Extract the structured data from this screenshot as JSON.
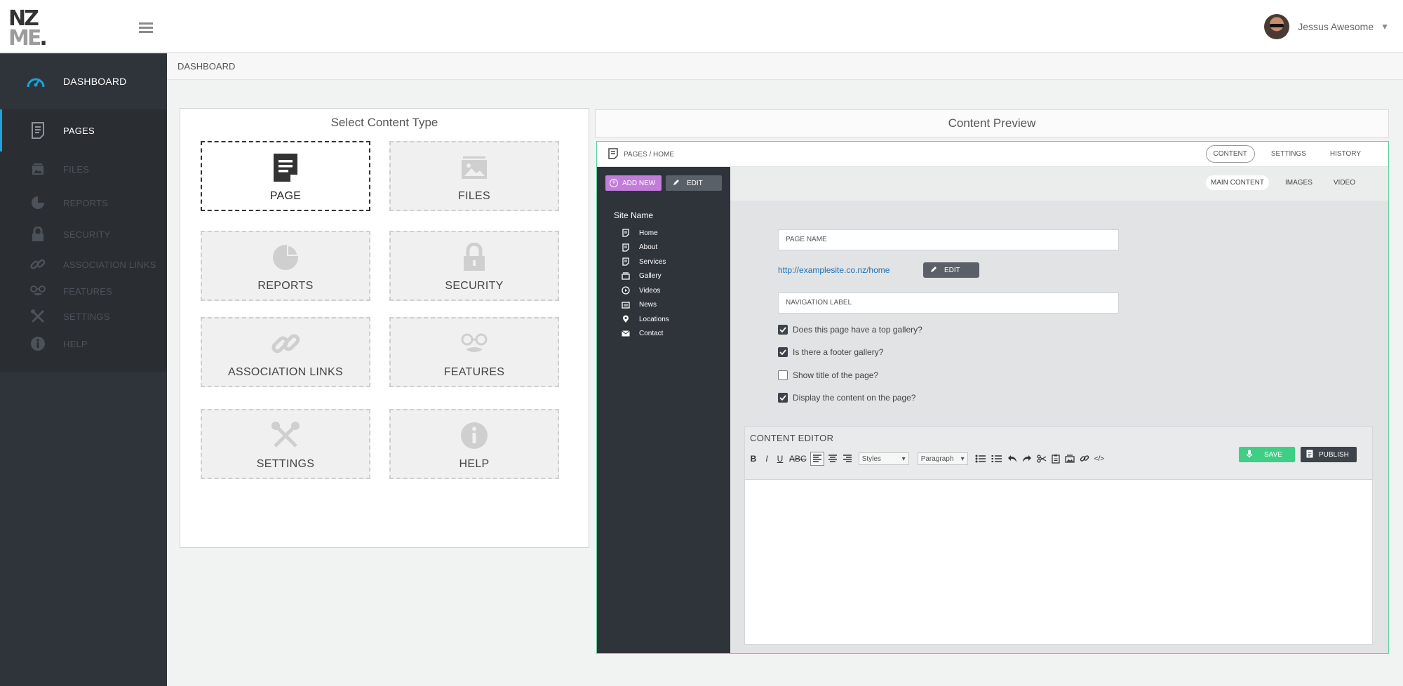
{
  "header": {
    "logo_line1": "NZ",
    "logo_line2": "ME",
    "user_name": "Jessus Awesome"
  },
  "sidebar": {
    "items": [
      {
        "label": "DASHBOARD"
      },
      {
        "label": "PAGES"
      },
      {
        "label": "FILES"
      },
      {
        "label": "REPORTS"
      },
      {
        "label": "SECURITY"
      },
      {
        "label": "ASSOCIATION LINKS"
      },
      {
        "label": "FEATURES"
      },
      {
        "label": "SETTINGS"
      },
      {
        "label": "HELP"
      }
    ]
  },
  "breadcrumb": "DASHBOARD",
  "select_panel": {
    "title": "Select Content Type",
    "tiles": [
      {
        "label": "PAGE"
      },
      {
        "label": "FILES"
      },
      {
        "label": "REPORTS"
      },
      {
        "label": "SECURITY"
      },
      {
        "label": "ASSOCIATION LINKS"
      },
      {
        "label": "FEATURES"
      },
      {
        "label": "SETTINGS"
      },
      {
        "label": "HELP"
      }
    ]
  },
  "preview": {
    "title": "Content Preview",
    "crumb": "PAGES / HOME",
    "tabs": [
      "CONTENT",
      "SETTINGS",
      "HISTORY"
    ],
    "subtabs": [
      "MAIN CONTENT",
      "IMAGES",
      "VIDEO"
    ],
    "add_new_label": "ADD NEW",
    "edit_label": "EDIT",
    "site_name": "Site Name",
    "site_items": [
      "Home",
      "About",
      "Services",
      "Gallery",
      "Videos",
      "News",
      "Locations",
      "Contact"
    ],
    "page_name_placeholder": "PAGE NAME",
    "url": "http://examplesite.co.nz/home",
    "url_edit_label": "EDIT",
    "nav_label_placeholder": "NAVIGATION LABEL",
    "checks": [
      {
        "label": "Does this page have a top gallery?",
        "checked": true
      },
      {
        "label": "Is there a footer gallery?",
        "checked": true
      },
      {
        "label": "Show title of the page?",
        "checked": false
      },
      {
        "label": "Display the content on the page?",
        "checked": true
      }
    ],
    "editor": {
      "title": "CONTENT EDITOR",
      "bold": "B",
      "italic": "I",
      "underline": "U",
      "strike": "ABC",
      "styles_label": "Styles",
      "paragraph_label": "Paragraph",
      "code_label": "</>",
      "save_label": "SAVE",
      "publish_label": "PUBLISH"
    }
  },
  "colors": {
    "accent_blue": "#1da3d9",
    "add_new_purple": "#c27cd9",
    "save_green": "#3fcf84",
    "preview_border": "#5cd19c",
    "sidebar_bg": "#2f343b"
  }
}
